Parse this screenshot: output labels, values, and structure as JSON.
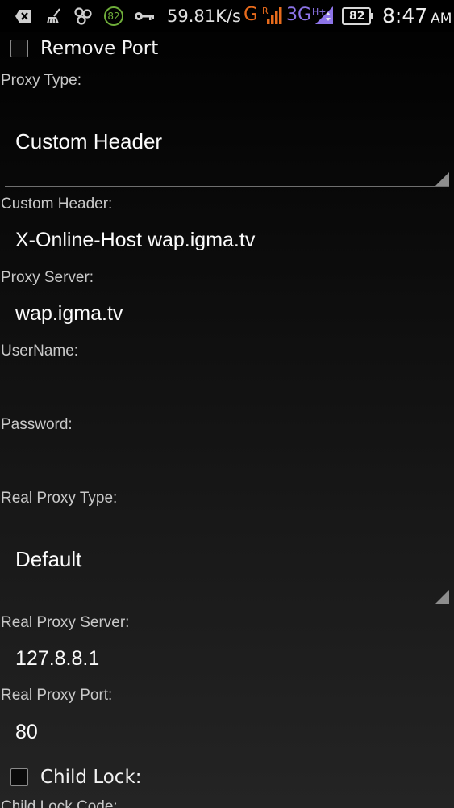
{
  "status_bar": {
    "battery_circle": "82",
    "net_speed": "59.81K/s",
    "signal_g": "G",
    "signal_r": "R",
    "signal_3g": "3G",
    "signal_h": "H+",
    "battery": "82",
    "time": "8:47",
    "ampm": "AM",
    "icons": [
      "back-arrow-icon",
      "cleaner-broom-icon",
      "usb-icon",
      "battery-saver-icon",
      "vpn-key-icon",
      "signal-bars-icon",
      "data-arrows-icon",
      "battery-icon"
    ],
    "colors": {
      "g_signal": "#e86b1c",
      "threeg_signal": "#8d74e8"
    }
  },
  "remove_port": {
    "label": "Remove Port",
    "checked": false
  },
  "proxy_type": {
    "label": "Proxy Type:",
    "value": "Custom Header"
  },
  "custom_header": {
    "label": "Custom Header:",
    "value": "X-Online-Host wap.igma.tv"
  },
  "proxy_server": {
    "label": "Proxy Server:",
    "value": "wap.igma.tv"
  },
  "username": {
    "label": "UserName:",
    "value": ""
  },
  "password": {
    "label": "Password:",
    "value": ""
  },
  "real_proxy_type": {
    "label": "Real Proxy Type:",
    "value": "Default"
  },
  "real_proxy_server": {
    "label": "Real Proxy Server:",
    "value": "127.8.8.1"
  },
  "real_proxy_port": {
    "label": "Real Proxy Port:",
    "value": "80"
  },
  "child_lock": {
    "label": "Child Lock:",
    "checked": false
  },
  "child_lock_code": {
    "label": "Child Lock Code:"
  }
}
